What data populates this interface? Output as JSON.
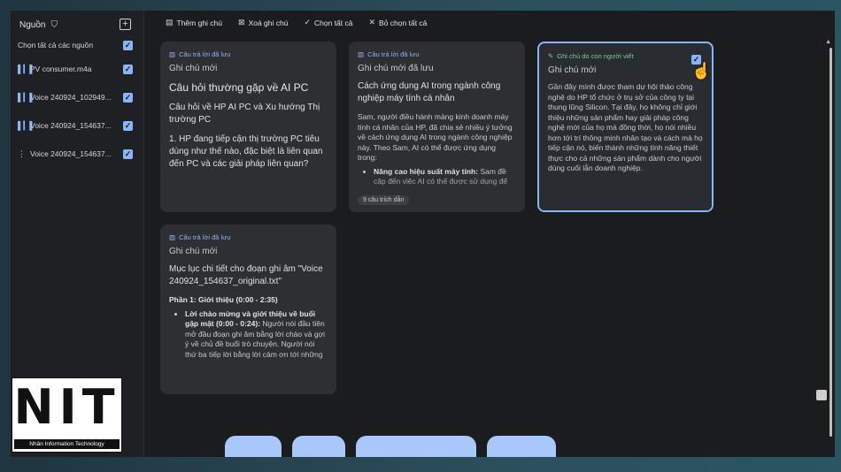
{
  "sidebar": {
    "title": "Nguồn",
    "select_all_label": "Chọn tất cả các nguồn",
    "sources": [
      {
        "name": "PV consumer.m4a",
        "icon": "audio-wave-icon",
        "checked": true
      },
      {
        "name": "Voice 240924_102949...",
        "icon": "audio-wave-icon",
        "checked": true
      },
      {
        "name": "Voice 240924_154637...",
        "icon": "audio-wave-icon",
        "checked": true
      },
      {
        "name": "Voice 240924_154637...",
        "icon": "more-vert-icon",
        "checked": true
      }
    ]
  },
  "toolbar": {
    "add_note": "Thêm ghi chú",
    "delete_note": "Xoá ghi chú",
    "select_all": "Chọn tất cả",
    "deselect_all": "Bỏ chọn tất cả"
  },
  "notes": [
    {
      "tag": "Câu trả lời đã lưu",
      "title": "Ghi chú mới",
      "heading": "Câu hỏi thường gặp về AI PC",
      "subheading": "Câu hỏi về HP AI PC và Xu hướng Thị trường PC",
      "body": "1. HP đang tiếp cận thị trường PC tiêu dùng như thế nào, đặc biệt là liên quan đến PC và các giải pháp liên quan?"
    },
    {
      "tag": "Câu trả lời đã lưu",
      "title": "Ghi chú mới đã lưu",
      "heading": "Cách ứng dụng AI trong ngành công nghiệp máy tính cá nhân",
      "body": "Sam, người điều hành mảng kinh doanh máy tính cá nhân của HP, đã chia sẻ nhiều ý tưởng về cách ứng dụng AI trong ngành công nghiệp này. Theo Sam, AI có thể được ứng dụng trong:",
      "bullet_bold": "Nâng cao hiệu suất máy tính:",
      "bullet_text": " Sam đề cập đến việc AI có thể được sử dụng để",
      "citation": "9 câu trích dẫn"
    },
    {
      "tag": "Ghi chú do con người viết",
      "title": "Ghi chú mới",
      "body": "Gần đây mình được tham dự hội thảo công nghệ do HP tổ chức ở trụ sở của công ty tại thung lũng Silicon. Tại đây, họ không chỉ giới thiệu những sản phẩm hay giải pháp công nghệ mới của họ mà đồng thời, họ nói nhiều hơn tới trí thông minh nhân tạo và cách mà họ tiếp cận nó, biến thành những tính năng thiết thực cho cả những sản phẩm dành cho người dùng cuối lẫn doanh nghiệp."
    },
    {
      "tag": "Câu trả lời đã lưu",
      "title": "Ghi chú mới",
      "heading": "Mục lục chi tiết cho đoạn ghi âm \"Voice 240924_154637_original.txt\"",
      "section": "Phần 1: Giới thiệu (0:00 - 2:35)",
      "bullet_bold": "Lời chào mừng và giới thiệu về buổi gặp mặt (0:00 - 0:24):",
      "bullet_text": " Người nói đầu tiên mở đầu đoạn ghi âm bằng lời chào và gợi ý về chủ đề buổi trò chuyện. Người nói thứ ba tiếp lời bằng lời cảm ơn tới những"
    }
  ],
  "logo": {
    "text": "NIT",
    "subtitle": "Nhân Information Technology"
  },
  "colors": {
    "accent": "#8ab4f8",
    "human_tag": "#81c995",
    "card_bg": "#2d2f33",
    "screen_bg": "#1b1c1e"
  }
}
